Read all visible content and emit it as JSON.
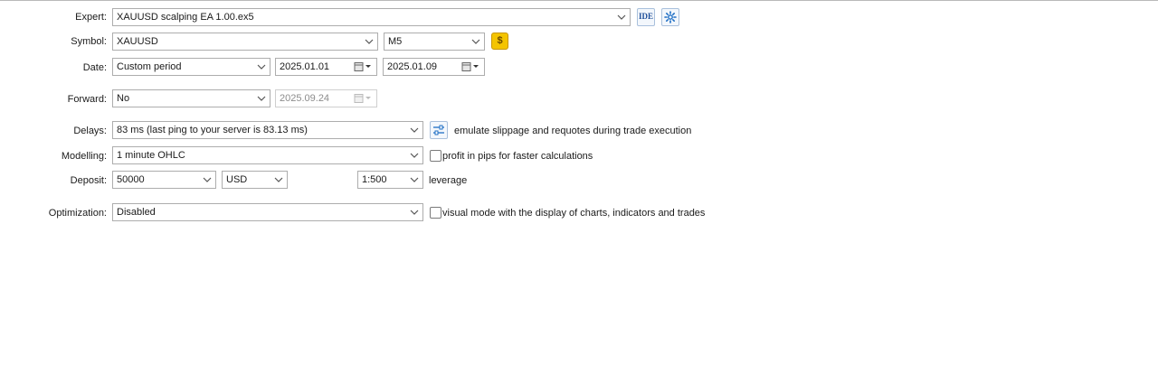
{
  "labels": {
    "expert": "Expert:",
    "symbol": "Symbol:",
    "date": "Date:",
    "forward": "Forward:",
    "delays": "Delays:",
    "modelling": "Modelling:",
    "deposit": "Deposit:",
    "optimization": "Optimization:"
  },
  "expert": {
    "value": "XAUUSD scalping EA 1.00.ex5",
    "ide_label": "IDE"
  },
  "symbol": {
    "value": "XAUUSD",
    "timeframe": "M5",
    "currency_icon_text": "$"
  },
  "date": {
    "period": "Custom period",
    "from": "2025.01.01",
    "to": "2025.01.09"
  },
  "forward": {
    "value": "No",
    "date": "2025.09.24"
  },
  "delays": {
    "value": "83 ms (last ping to your server is 83.13 ms)",
    "option_text": "emulate slippage and requotes during trade execution"
  },
  "modelling": {
    "value": "1 minute OHLC",
    "checkbox_text": "profit in pips for faster calculations",
    "checked": false
  },
  "deposit": {
    "amount": "50000",
    "currency": "USD",
    "leverage": "1:500",
    "leverage_text": "leverage"
  },
  "optimization": {
    "value": "Disabled",
    "checkbox_text": "visual mode with the display of charts, indicators and trades",
    "checked": false
  },
  "colors": {
    "accent": "#1f6fc5",
    "gold": "#e8b400",
    "border": "#adadad"
  }
}
